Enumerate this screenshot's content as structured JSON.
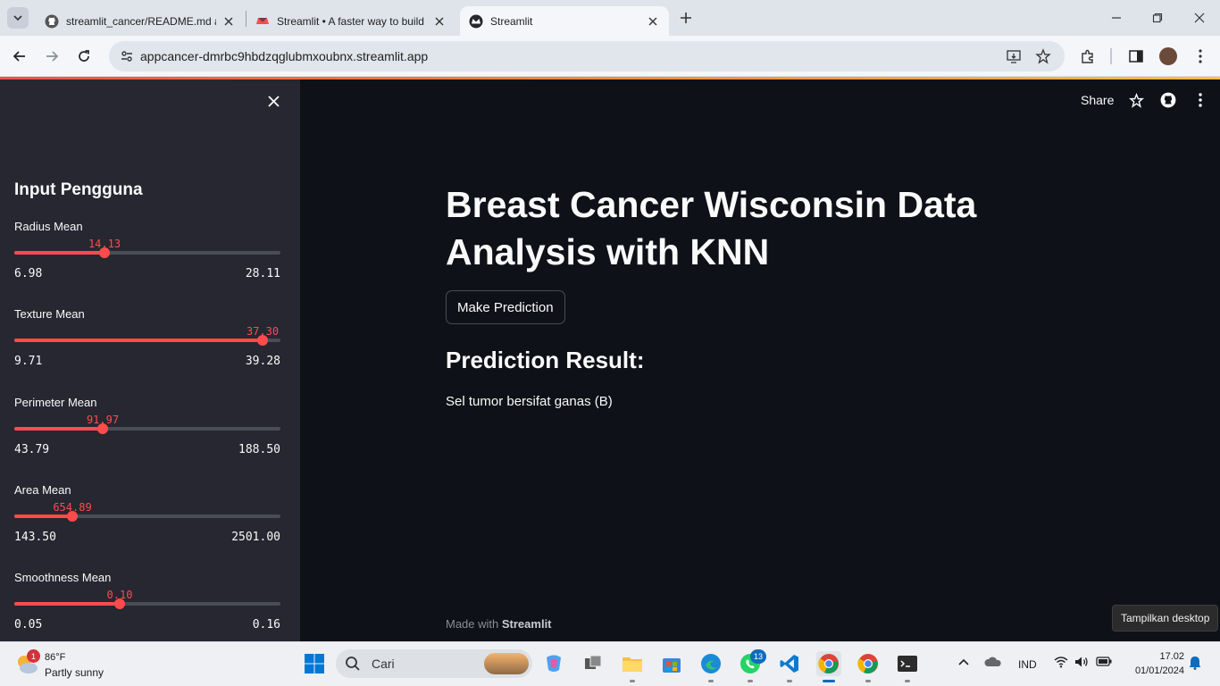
{
  "browser": {
    "tabs": [
      {
        "title": "streamlit_cancer/README.md a",
        "icon": "github-icon",
        "active": false
      },
      {
        "title": "Streamlit • A faster way to build",
        "icon": "streamlit-crown-icon",
        "active": false
      },
      {
        "title": "Streamlit",
        "icon": "streamlit-crown-icon",
        "active": true
      }
    ],
    "url": "appcancer-dmrbc9hbdzqglubmxoubnx.streamlit.app"
  },
  "app": {
    "header": {
      "share_label": "Share"
    },
    "sidebar": {
      "title": "Input Pengguna",
      "sliders": [
        {
          "label": "Radius Mean",
          "value": "14.13",
          "min": "6.98",
          "max": "28.11",
          "fraction": 0.338
        },
        {
          "label": "Texture Mean",
          "value": "37.30",
          "min": "9.71",
          "max": "39.28",
          "fraction": 0.933
        },
        {
          "label": "Perimeter Mean",
          "value": "91.97",
          "min": "43.79",
          "max": "188.50",
          "fraction": 0.333
        },
        {
          "label": "Area Mean",
          "value": "654.89",
          "min": "143.50",
          "max": "2501.00",
          "fraction": 0.217
        },
        {
          "label": "Smoothness Mean",
          "value": "0.10",
          "min": "0.05",
          "max": "0.16",
          "fraction": 0.396
        }
      ]
    },
    "main": {
      "title": "Breast Cancer Wisconsin Data Analysis with KNN",
      "button_label": "Make Prediction",
      "result_heading": "Prediction Result:",
      "result_text": "Sel tumor bersifat ganas (B)",
      "footer_prefix": "Made with",
      "footer_brand": "Streamlit"
    },
    "accent_color": "#ff4b4b",
    "background_color": "#0e1117",
    "sidebar_color": "#262730"
  },
  "taskbar": {
    "weather_badge": "1",
    "weather_temp": "86°F",
    "weather_desc": "Partly sunny",
    "search_placeholder": "Cari",
    "whatsapp_badge": "13",
    "language": "IND",
    "time": "17.02",
    "date": "01/01/2024",
    "tooltip": "Tampilkan desktop"
  }
}
